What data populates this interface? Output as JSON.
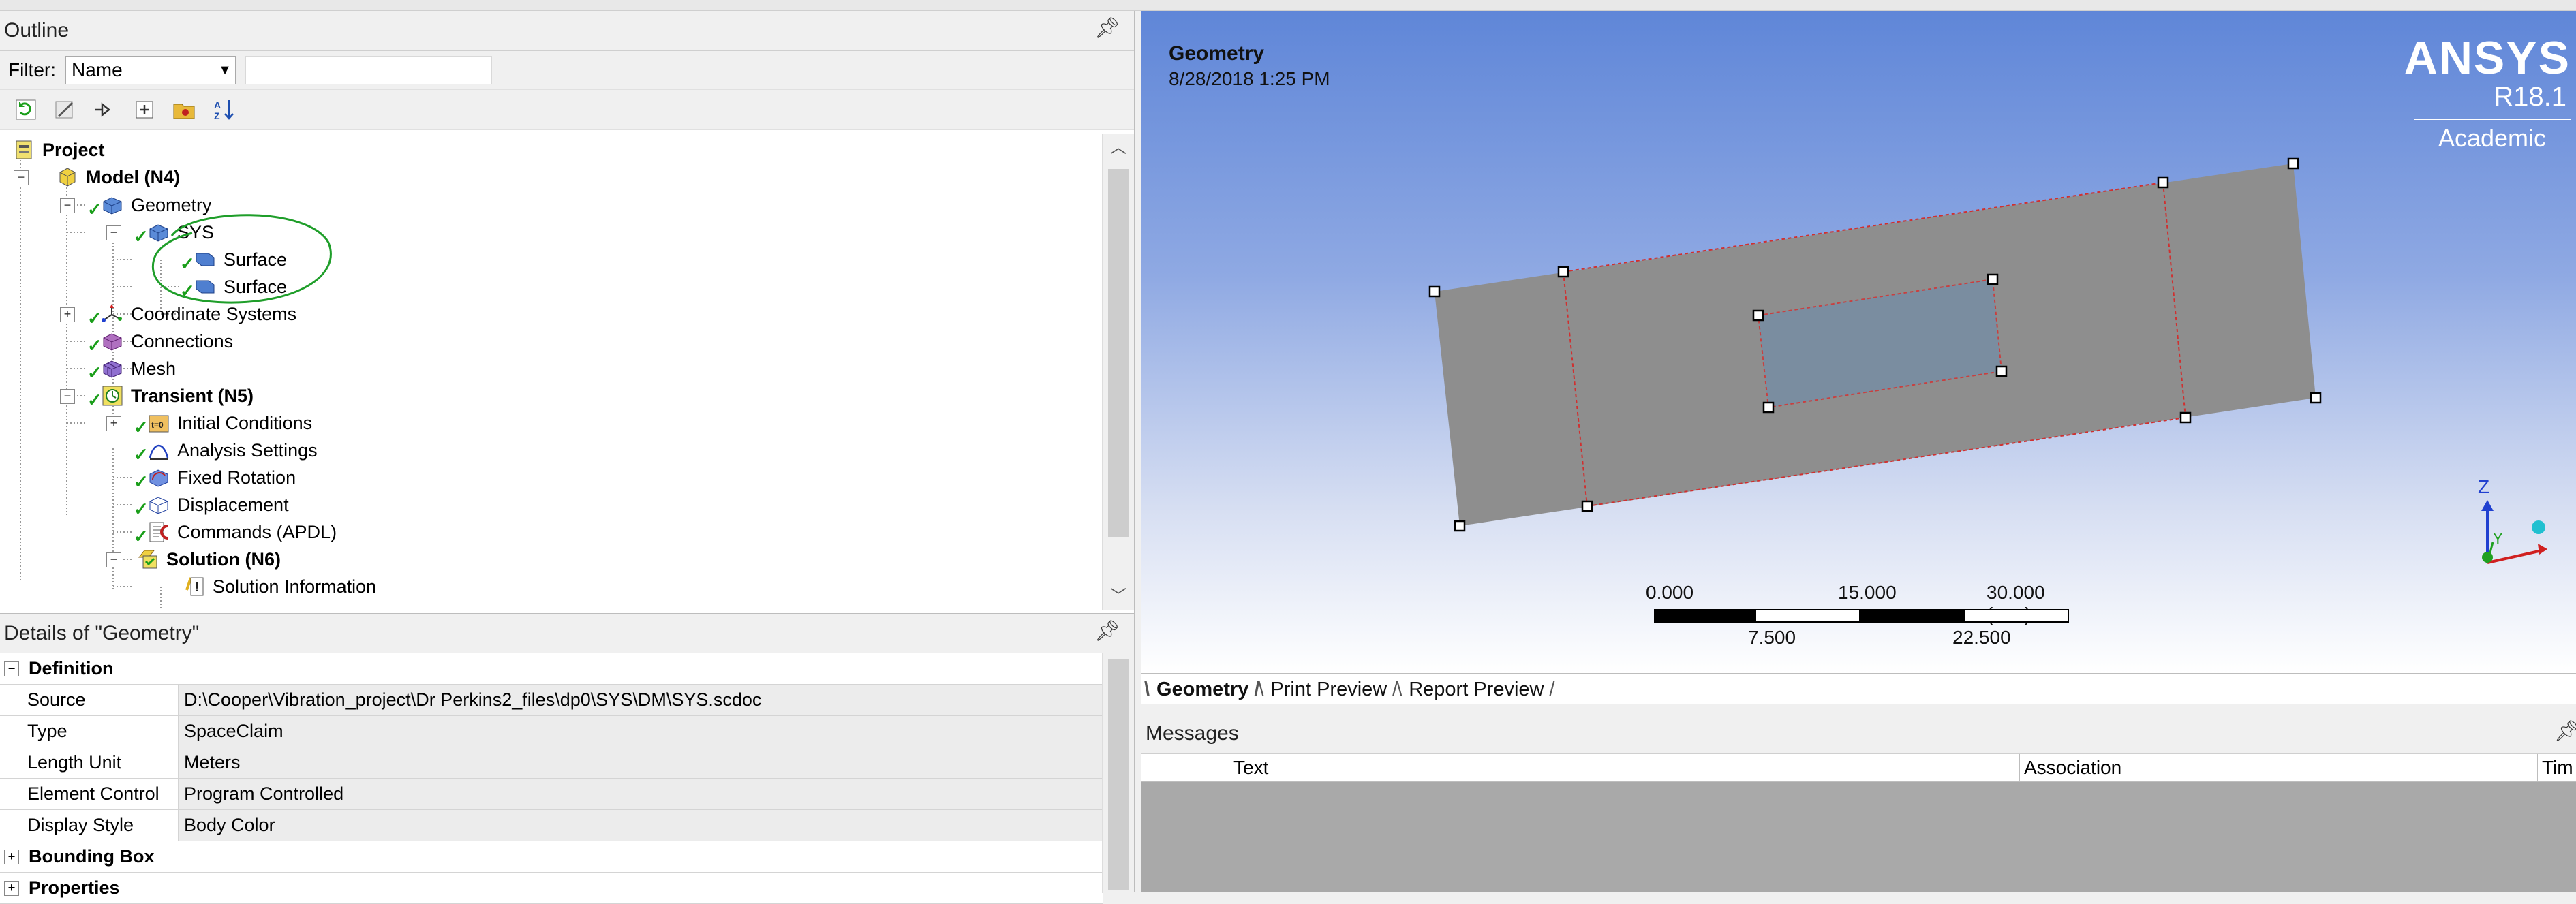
{
  "outline": {
    "title": "Outline",
    "filter_label": "Filter:",
    "filter_value": "Name",
    "tree": [
      {
        "label": "Project"
      },
      {
        "label": "Model (N4)"
      },
      {
        "label": "Geometry"
      },
      {
        "label": "SYS"
      },
      {
        "label": "Surface"
      },
      {
        "label": "Surface"
      },
      {
        "label": "Coordinate Systems"
      },
      {
        "label": "Connections"
      },
      {
        "label": "Mesh"
      },
      {
        "label": "Transient (N5)"
      },
      {
        "label": "Initial Conditions"
      },
      {
        "label": "Analysis Settings"
      },
      {
        "label": "Fixed Rotation"
      },
      {
        "label": "Displacement"
      },
      {
        "label": "Commands (APDL)"
      },
      {
        "label": "Solution (N6)"
      },
      {
        "label": "Solution Information"
      }
    ]
  },
  "details": {
    "title": "Details of \"Geometry\"",
    "group_definition": "Definition",
    "rows": [
      {
        "key": "Source",
        "value": "D:\\Cooper\\Vibration_project\\Dr Perkins2_files\\dp0\\SYS\\DM\\SYS.scdoc"
      },
      {
        "key": "Type",
        "value": "SpaceClaim"
      },
      {
        "key": "Length Unit",
        "value": "Meters"
      },
      {
        "key": "Element Control",
        "value": "Program Controlled"
      },
      {
        "key": "Display Style",
        "value": "Body Color"
      }
    ],
    "group_bounding": "Bounding Box",
    "group_properties": "Properties"
  },
  "viewport": {
    "title": "Geometry",
    "date": "8/28/2018 1:25 PM",
    "logo": "ANSYS",
    "version": "R18.1",
    "edition": "Academic",
    "axis_z": "Z",
    "axis_y": "Y",
    "scale": {
      "t0": "0.000",
      "t1": "15.000",
      "t2": "30.000 (mm)",
      "b1": "7.500",
      "b2": "22.500"
    }
  },
  "tabs": [
    "Geometry",
    "Print Preview",
    "Report Preview"
  ],
  "messages": {
    "title": "Messages",
    "columns": [
      "Text",
      "Association",
      "Tim"
    ]
  }
}
